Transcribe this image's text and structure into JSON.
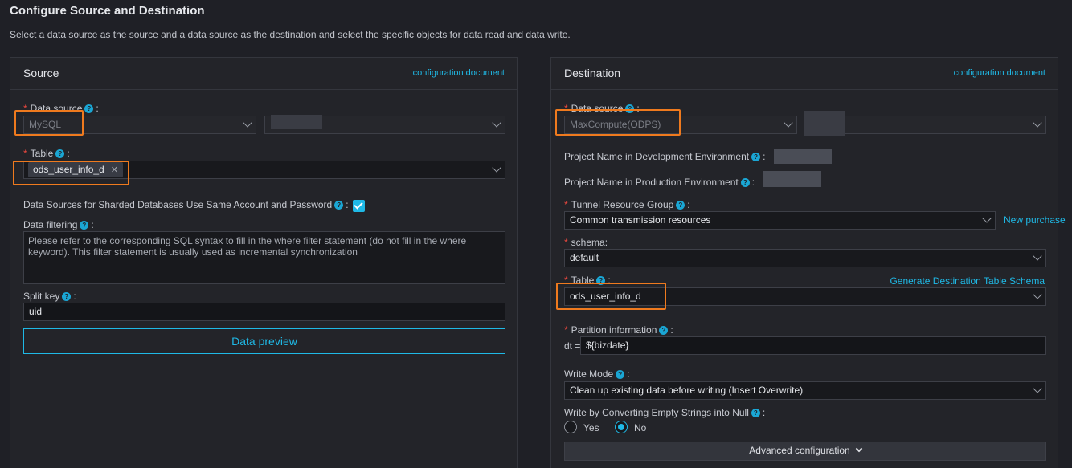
{
  "page": {
    "title": "Configure Source and Destination",
    "description": "Select a data source as the source and a data source as the destination and select the specific objects for data read and data write."
  },
  "source": {
    "title": "Source",
    "config_doc": "configuration document",
    "data_source_label": "Data source",
    "data_source_type": "MySQL",
    "table_label": "Table",
    "table_tag": "ods_user_info_d",
    "sharded_label": "Data Sources for Sharded Databases Use Same Account and Password",
    "filtering_label": "Data filtering",
    "filtering_placeholder": "Please refer to the corresponding SQL syntax to fill in the where filter statement (do not fill in the where keyword). This filter statement is usually used as incremental synchronization",
    "split_key_label": "Split key",
    "split_key_value": "uid",
    "preview_button": "Data preview"
  },
  "destination": {
    "title": "Destination",
    "config_doc": "configuration document",
    "data_source_label": "Data source",
    "data_source_type": "MaxCompute(ODPS)",
    "project_dev_label": "Project Name in Development Environment",
    "project_prod_label": "Project Name in Production Environment",
    "tunnel_label": "Tunnel Resource Group",
    "tunnel_value": "Common transmission resources",
    "new_purchase": "New purchase",
    "schema_label": "schema",
    "schema_value": "default",
    "table_label": "Table",
    "generate_schema": "Generate Destination Table Schema",
    "table_value": "ods_user_info_d",
    "partition_label": "Partition information",
    "partition_prefix": "dt =",
    "partition_value": "${bizdate}",
    "write_mode_label": "Write Mode",
    "write_mode_value": "Clean up existing data before writing (Insert Overwrite)",
    "empty_null_label": "Write by Converting Empty Strings into Null",
    "yes_label": "Yes",
    "no_label": "No",
    "advanced_button": "Advanced configuration"
  },
  "colors": {
    "accent": "#1fb9e6",
    "highlight": "#ef7a1e",
    "required": "#e8473e"
  }
}
